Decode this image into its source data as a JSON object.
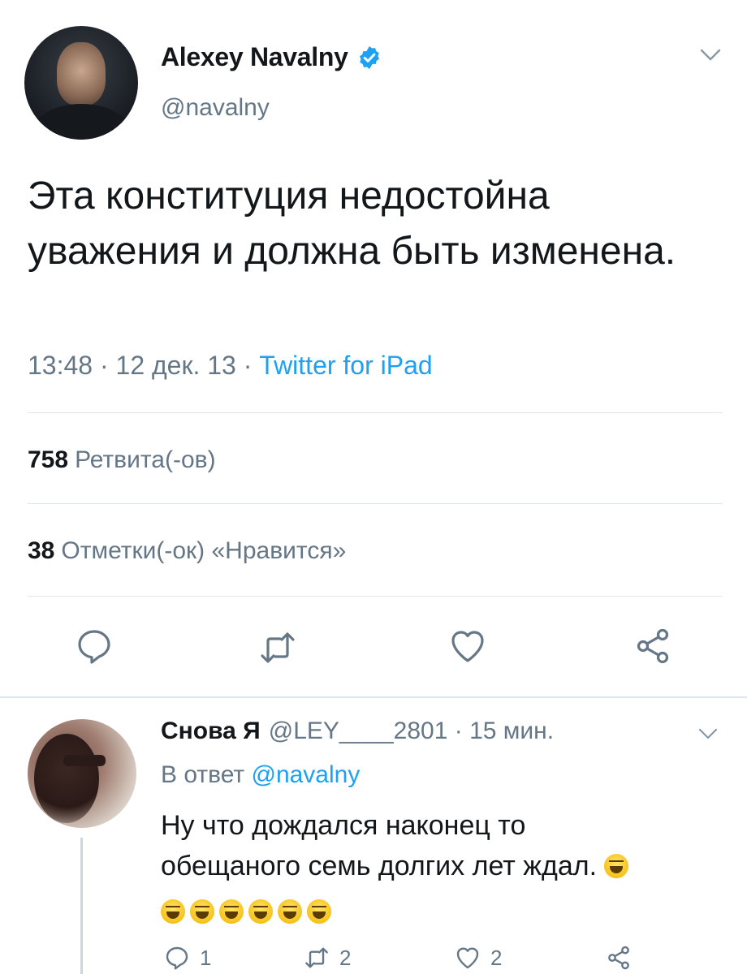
{
  "tweet": {
    "author_name": "Alexey Navalny",
    "author_handle": "@navalny",
    "text": "Эта конституция недостойна уважения и должна быть изменена.",
    "time": "13:48",
    "date": "12 дек. 13",
    "source": "Twitter for iPad",
    "separator": " · ",
    "retweets_count": "758",
    "retweets_label": "Ретвита(-ов)",
    "likes_count": "38",
    "likes_label": "Отметки(-ок) «Нравится»"
  },
  "reply": {
    "author_name": "Снова Я",
    "author_handle": "@LEY____2801",
    "age": "15 мин.",
    "in_reply_to_prefix": "В ответ ",
    "in_reply_to_handle": "@navalny",
    "text_line1": "Ну что дождался наконец то",
    "text_line2": "обещаного семь долгих лет ждал.",
    "emoji_count": 7,
    "counts": {
      "replies": "1",
      "retweets": "2",
      "likes": "2"
    }
  },
  "colors": {
    "text": "#14171a",
    "secondary": "#657786",
    "link": "#1da1f2",
    "divider": "#e1e8ed",
    "icon": "#657786"
  },
  "icons": [
    "chevron-down-icon",
    "verified-badge-icon",
    "reply-icon",
    "retweet-icon",
    "like-icon",
    "share-icon",
    "emoji-grinning-squinting-icon"
  ]
}
